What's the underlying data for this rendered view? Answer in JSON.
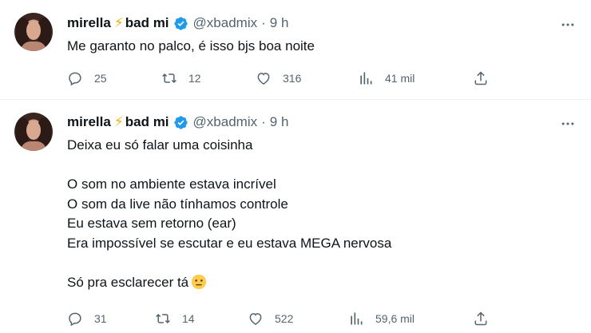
{
  "tweets": [
    {
      "name": "mirella",
      "name_suffix": "bad mi",
      "handle": "@xbadmix",
      "separator": "·",
      "time": "9 h",
      "text": "Me garanto no palco, é isso bjs boa noite",
      "replies": "25",
      "retweets": "12",
      "likes": "316",
      "views": "41 mil"
    },
    {
      "name": "mirella",
      "name_suffix": "bad mi",
      "handle": "@xbadmix",
      "separator": "·",
      "time": "9 h",
      "text": "Deixa eu só falar uma coisinha\n\nO som no ambiente estava incrível\nO som da live não tínhamos controle\nEu estava sem retorno (ear)\nEra impossível se escutar e eu estava MEGA nervosa\n\nSó pra esclarecer tá",
      "replies": "31",
      "retweets": "14",
      "likes": "522",
      "views": "59,6 mil"
    }
  ],
  "icons": {
    "verified": "verified-badge-icon",
    "bolt": "lightning-bolt-emoji",
    "emoji_end": "neutral-face-emoji"
  },
  "colors": {
    "verified_blue": "#1d9bf0",
    "muted_text": "#536471",
    "bolt_yellow": "#f4b400"
  }
}
